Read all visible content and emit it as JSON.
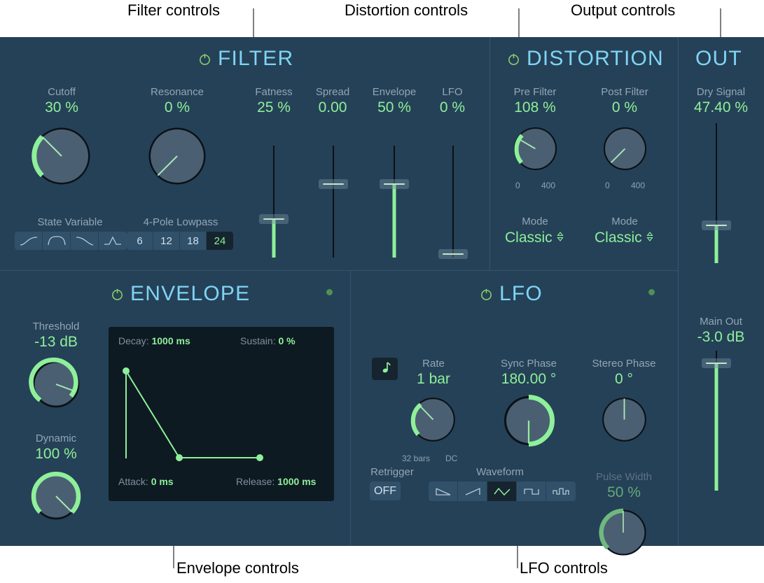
{
  "annotations": [
    {
      "id": "filter-controls",
      "text": "Filter controls"
    },
    {
      "id": "distortion-controls",
      "text": "Distortion controls"
    },
    {
      "id": "output-controls",
      "text": "Output controls"
    },
    {
      "id": "envelope-controls",
      "text": "Envelope controls"
    },
    {
      "id": "lfo-controls",
      "text": "LFO controls"
    }
  ],
  "colors": {
    "panel_bg": "#254157",
    "accent_green": "#8ef09a",
    "header_blue": "#7fd4f5",
    "label_gray": "#93a6b5",
    "divider": "#34546c",
    "button_bg": "#31506a",
    "button_on_bg": "#16242f",
    "graph_bg": "#0e1a22",
    "led_green": "#4f9152"
  },
  "filter": {
    "title": "FILTER",
    "power": "power-icon",
    "cutoff": {
      "label": "Cutoff",
      "value": "30 %"
    },
    "resonance": {
      "label": "Resonance",
      "value": "0 %"
    },
    "fatness": {
      "label": "Fatness",
      "value": "25 %"
    },
    "spread": {
      "label": "Spread",
      "value": "0.00"
    },
    "envelope": {
      "label": "Envelope",
      "value": "50 %"
    },
    "lfo": {
      "label": "LFO",
      "value": "0 %"
    },
    "mode_label": "State Variable",
    "slope_label": "4-Pole Lowpass",
    "shape_buttons": [
      {
        "name": "lowpass",
        "icon": "lowpass-curve-icon",
        "selected": false
      },
      {
        "name": "bandpass",
        "icon": "bandpass-curve-icon",
        "selected": false
      },
      {
        "name": "highpass",
        "icon": "highpass-curve-icon",
        "selected": false
      },
      {
        "name": "peak",
        "icon": "peak-curve-icon",
        "selected": false
      }
    ],
    "slope_buttons": [
      {
        "label": "6",
        "selected": false
      },
      {
        "label": "12",
        "selected": false
      },
      {
        "label": "18",
        "selected": false
      },
      {
        "label": "24",
        "selected": true
      }
    ]
  },
  "distortion": {
    "title": "DISTORTION",
    "power": "power-icon",
    "pre_filter": {
      "label": "Pre Filter",
      "value": "108 %",
      "scale_min": "0",
      "scale_max": "400"
    },
    "post_filter": {
      "label": "Post Filter",
      "value": "0 %",
      "scale_min": "0",
      "scale_max": "400"
    },
    "pre_mode": {
      "label": "Mode",
      "value": "Classic"
    },
    "post_mode": {
      "label": "Mode",
      "value": "Classic"
    }
  },
  "out": {
    "title": "OUT",
    "dry_signal": {
      "label": "Dry Signal",
      "value": "47.40 %"
    },
    "main_out": {
      "label": "Main Out",
      "value": "-3.0 dB"
    }
  },
  "envelope": {
    "title": "ENVELOPE",
    "power": "power-icon",
    "threshold": {
      "label": "Threshold",
      "value": "-13 dB"
    },
    "dynamic": {
      "label": "Dynamic",
      "value": "100 %"
    },
    "graph": {
      "decay_label": "Decay:",
      "decay_value": "1000 ms",
      "sustain_label": "Sustain:",
      "sustain_value": "0 %",
      "attack_label": "Attack:",
      "attack_value": "0 ms",
      "release_label": "Release:",
      "release_value": "1000 ms"
    }
  },
  "lfo": {
    "title": "LFO",
    "power": "power-icon",
    "note_button": "note-icon",
    "rate": {
      "label": "Rate",
      "value": "1 bar",
      "scale_min": "32 bars",
      "scale_max": "DC"
    },
    "sync_phase": {
      "label": "Sync Phase",
      "value": "180.00 °"
    },
    "stereo_phase": {
      "label": "Stereo Phase",
      "value": "0 °"
    },
    "pulse_width": {
      "label": "Pulse Width",
      "value": "50 %"
    },
    "retrigger": {
      "label": "Retrigger",
      "value": "OFF"
    },
    "waveform_label": "Waveform",
    "waveform_buttons": [
      {
        "name": "saw-down",
        "icon": "saw-down-icon",
        "selected": false
      },
      {
        "name": "saw-up",
        "icon": "saw-up-icon",
        "selected": false
      },
      {
        "name": "triangle",
        "icon": "triangle-icon",
        "selected": true
      },
      {
        "name": "square",
        "icon": "square-icon",
        "selected": false
      },
      {
        "name": "random",
        "icon": "random-step-icon",
        "selected": false
      }
    ]
  }
}
